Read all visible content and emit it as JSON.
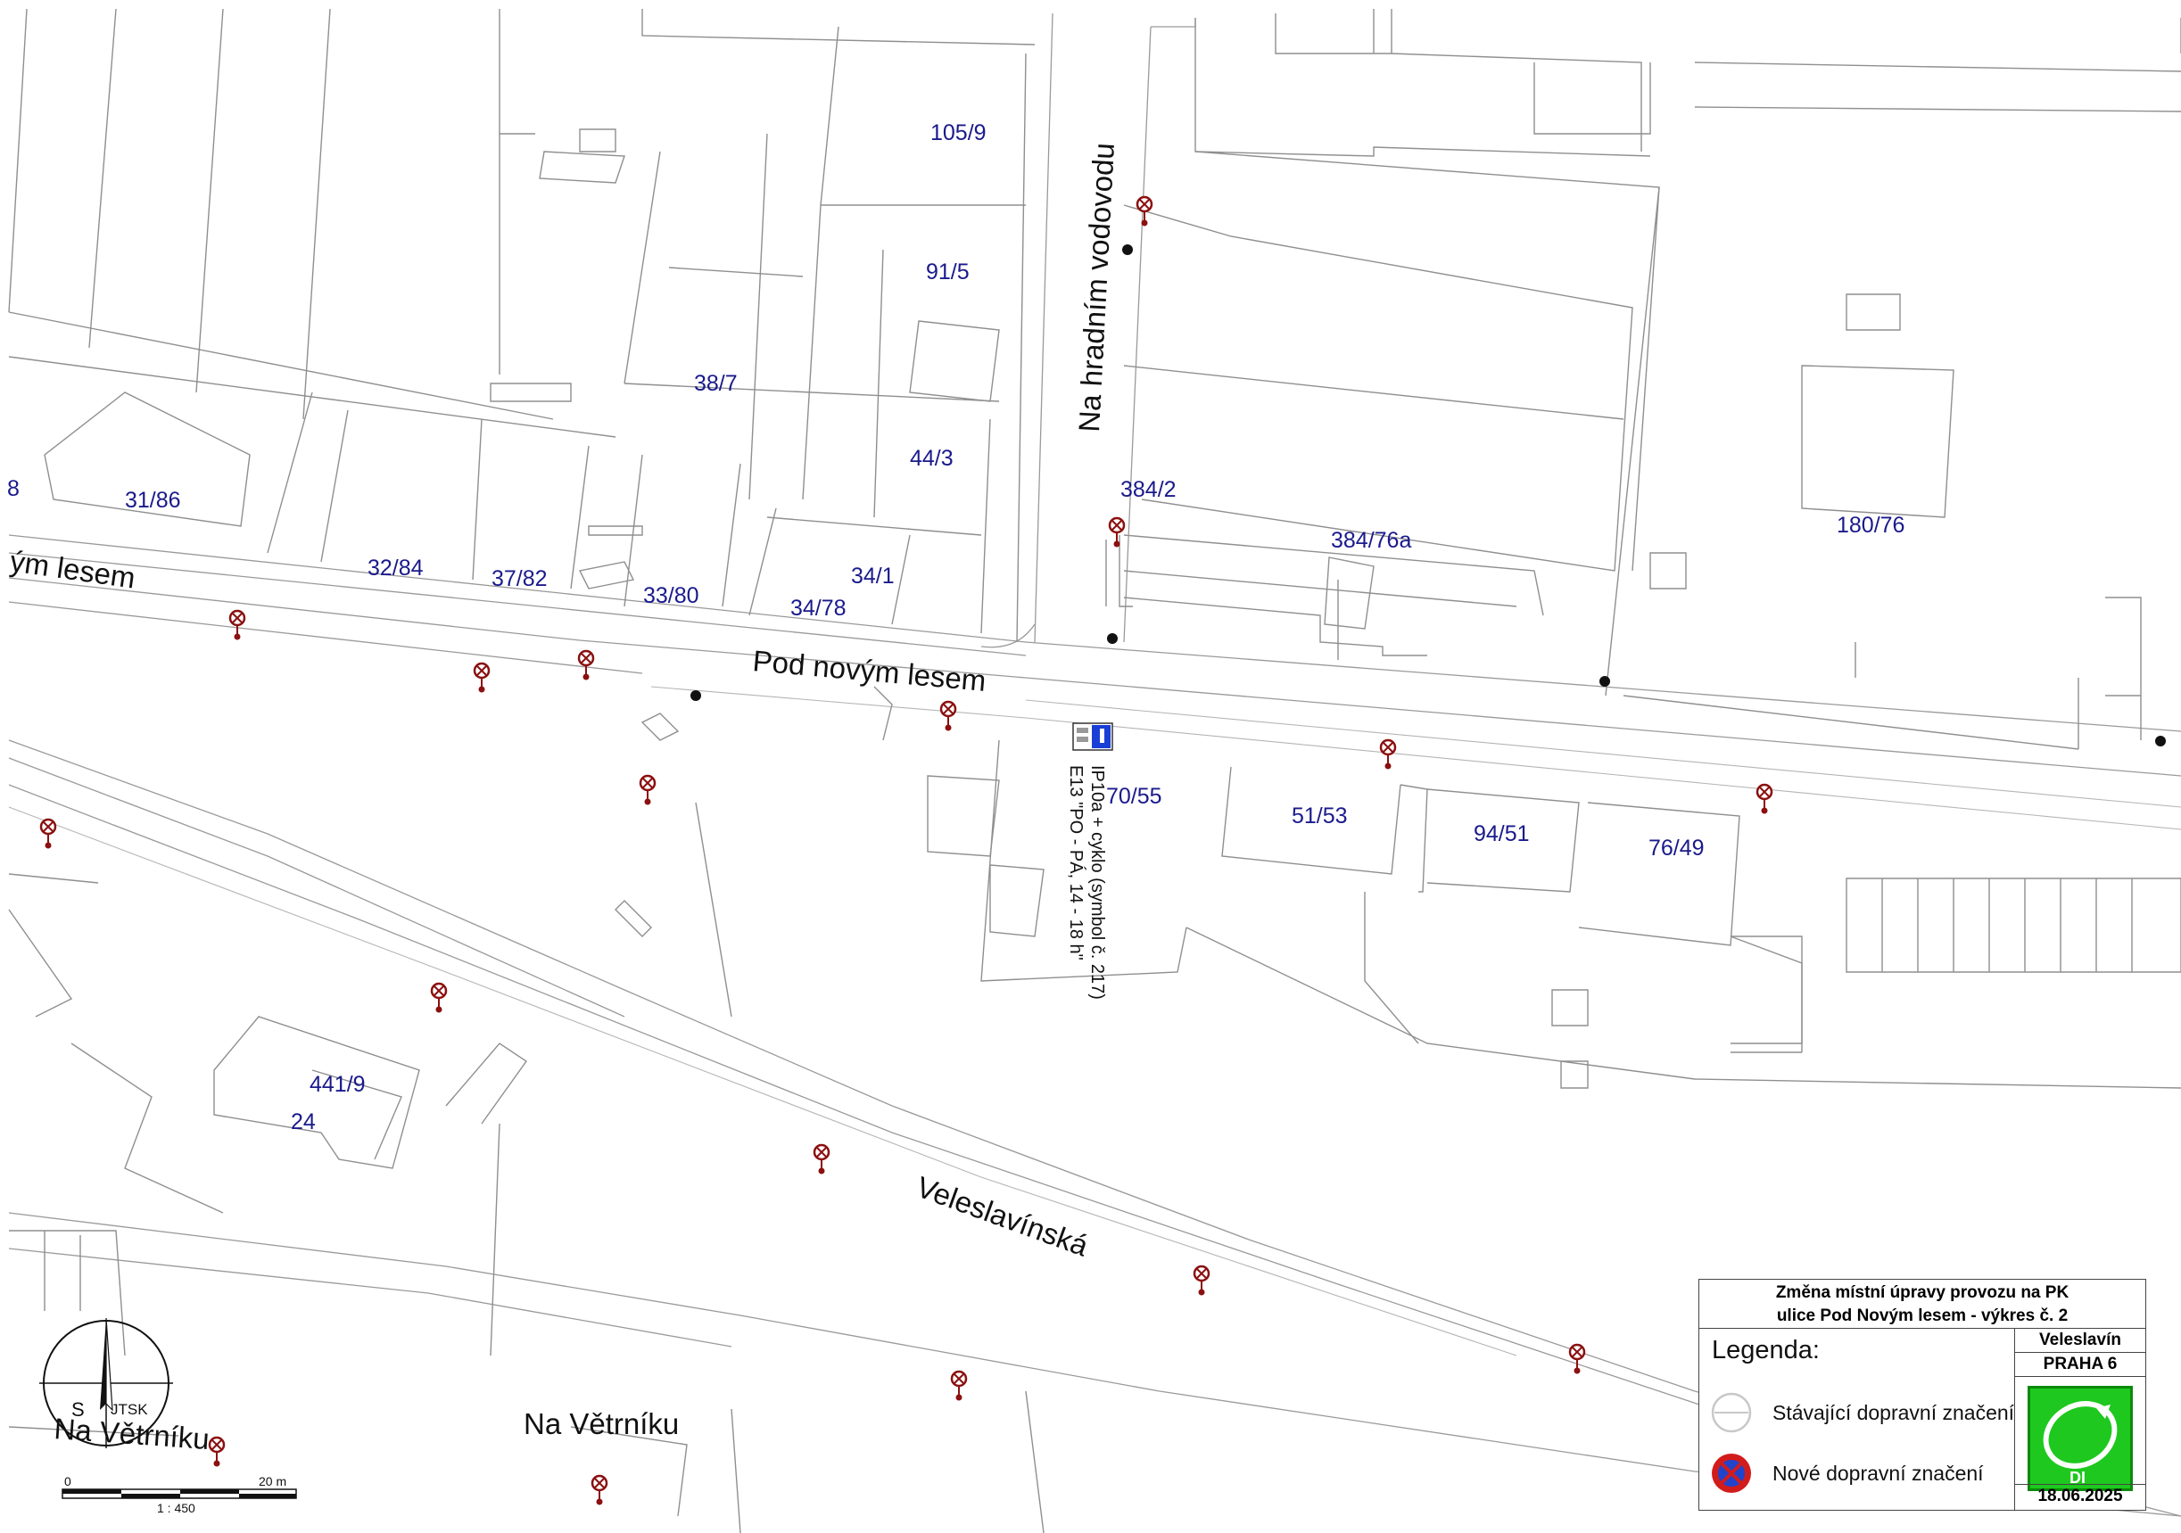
{
  "map": {
    "streets": [
      "Pod novým lesem",
      "ým lesem",
      "Na hradním vodovodu",
      "Veleslavínská",
      "Na Větrníku",
      "Na Větrníku"
    ],
    "parcels": [
      "105/9",
      "91/5",
      "38/7",
      "44/3",
      "384/2",
      "384/76a",
      "180/76",
      "31/86",
      "32/84",
      "37/82",
      "33/80",
      "34/78",
      "34/1",
      "70/55",
      "51/53",
      "94/51",
      "76/49",
      "441/9",
      "24",
      "8"
    ],
    "sign_annotation": [
      "IP10a + cyklo (symbol č. 217)",
      "E13 \"PO - PÁ, 14 - 18 h\""
    ]
  },
  "title": {
    "line1": "Změna místní úpravy provozu na PK",
    "line2": "ulice Pod Novým lesem - výkres č. 2"
  },
  "legend": {
    "title": "Legenda:",
    "existing": "Stávající dopravní značení",
    "new": "Nové dopravní značení"
  },
  "info": {
    "locality": "Veleslavín",
    "district": "PRAHA 6",
    "logo_text": "DI",
    "date": "18.06.2025"
  },
  "north_arrow": {
    "south": "S",
    "system": "JTSK"
  },
  "scale": {
    "start": "0",
    "end": "20 m",
    "ratio": "1 : 450"
  },
  "colors": {
    "parcel_text": "#1a1a8c",
    "sign": "#8b1010",
    "logo_green": "#1ec81e",
    "ip_sign_blue": "#1a3fd6"
  }
}
